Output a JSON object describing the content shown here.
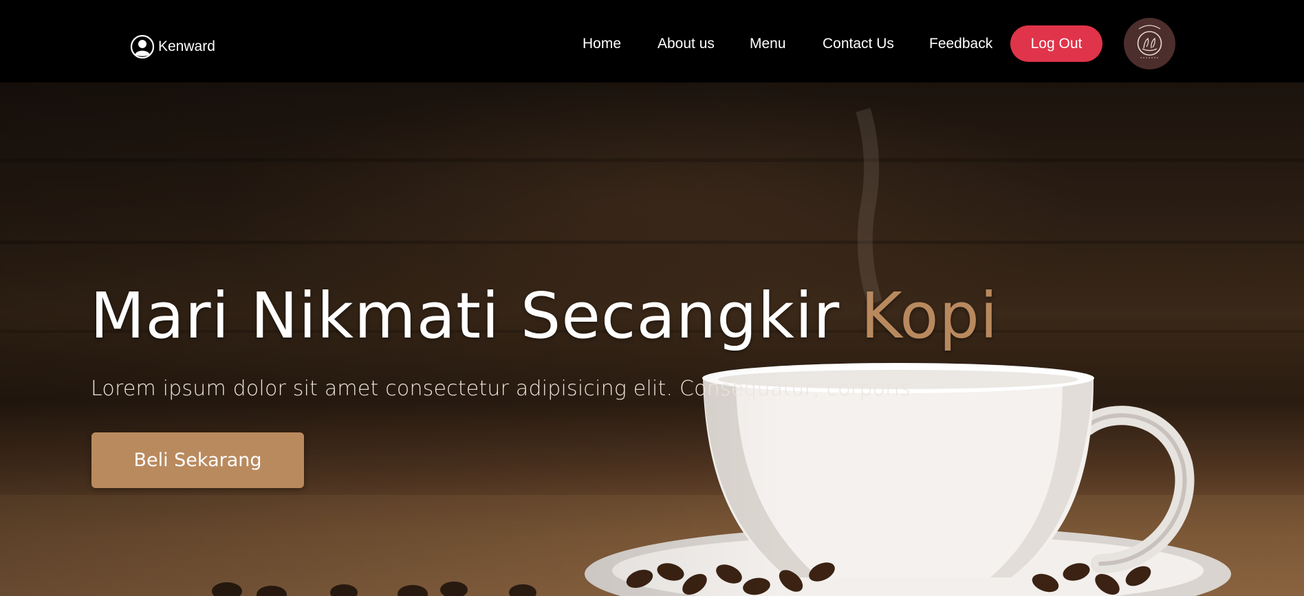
{
  "navbar": {
    "username": "Kenward",
    "links": [
      "Home",
      "About us",
      "Menu",
      "Contact Us",
      "Feedback"
    ],
    "logout_label": "Log Out",
    "logout_color": "#e0344a",
    "logo_color": "#4c2e2c",
    "user_icon": "user-circle-icon",
    "logo_icon": "coffee-logo-icon"
  },
  "hero": {
    "title_main": "Mari Nikmati Secangkir ",
    "title_accent": "Kopi",
    "accent_color": "#b9895e",
    "subtitle": "Lorem ipsum dolor sit amet consectetur adipisicing elit. Consequatur, corporis.",
    "cta_label": "Beli Sekarang",
    "cta_color": "#b98a5e"
  }
}
